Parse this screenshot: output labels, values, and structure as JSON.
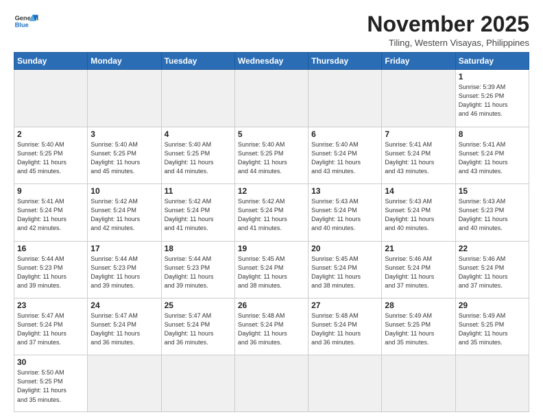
{
  "header": {
    "logo_line1": "General",
    "logo_line2": "Blue",
    "month_title": "November 2025",
    "location": "Tiling, Western Visayas, Philippines"
  },
  "weekdays": [
    "Sunday",
    "Monday",
    "Tuesday",
    "Wednesday",
    "Thursday",
    "Friday",
    "Saturday"
  ],
  "weeks": [
    [
      {
        "day": "",
        "info": ""
      },
      {
        "day": "",
        "info": ""
      },
      {
        "day": "",
        "info": ""
      },
      {
        "day": "",
        "info": ""
      },
      {
        "day": "",
        "info": ""
      },
      {
        "day": "",
        "info": ""
      },
      {
        "day": "1",
        "info": "Sunrise: 5:39 AM\nSunset: 5:26 PM\nDaylight: 11 hours\nand 46 minutes."
      }
    ],
    [
      {
        "day": "2",
        "info": "Sunrise: 5:40 AM\nSunset: 5:25 PM\nDaylight: 11 hours\nand 45 minutes."
      },
      {
        "day": "3",
        "info": "Sunrise: 5:40 AM\nSunset: 5:25 PM\nDaylight: 11 hours\nand 45 minutes."
      },
      {
        "day": "4",
        "info": "Sunrise: 5:40 AM\nSunset: 5:25 PM\nDaylight: 11 hours\nand 44 minutes."
      },
      {
        "day": "5",
        "info": "Sunrise: 5:40 AM\nSunset: 5:25 PM\nDaylight: 11 hours\nand 44 minutes."
      },
      {
        "day": "6",
        "info": "Sunrise: 5:40 AM\nSunset: 5:24 PM\nDaylight: 11 hours\nand 43 minutes."
      },
      {
        "day": "7",
        "info": "Sunrise: 5:41 AM\nSunset: 5:24 PM\nDaylight: 11 hours\nand 43 minutes."
      },
      {
        "day": "8",
        "info": "Sunrise: 5:41 AM\nSunset: 5:24 PM\nDaylight: 11 hours\nand 43 minutes."
      }
    ],
    [
      {
        "day": "9",
        "info": "Sunrise: 5:41 AM\nSunset: 5:24 PM\nDaylight: 11 hours\nand 42 minutes."
      },
      {
        "day": "10",
        "info": "Sunrise: 5:42 AM\nSunset: 5:24 PM\nDaylight: 11 hours\nand 42 minutes."
      },
      {
        "day": "11",
        "info": "Sunrise: 5:42 AM\nSunset: 5:24 PM\nDaylight: 11 hours\nand 41 minutes."
      },
      {
        "day": "12",
        "info": "Sunrise: 5:42 AM\nSunset: 5:24 PM\nDaylight: 11 hours\nand 41 minutes."
      },
      {
        "day": "13",
        "info": "Sunrise: 5:43 AM\nSunset: 5:24 PM\nDaylight: 11 hours\nand 40 minutes."
      },
      {
        "day": "14",
        "info": "Sunrise: 5:43 AM\nSunset: 5:24 PM\nDaylight: 11 hours\nand 40 minutes."
      },
      {
        "day": "15",
        "info": "Sunrise: 5:43 AM\nSunset: 5:23 PM\nDaylight: 11 hours\nand 40 minutes."
      }
    ],
    [
      {
        "day": "16",
        "info": "Sunrise: 5:44 AM\nSunset: 5:23 PM\nDaylight: 11 hours\nand 39 minutes."
      },
      {
        "day": "17",
        "info": "Sunrise: 5:44 AM\nSunset: 5:23 PM\nDaylight: 11 hours\nand 39 minutes."
      },
      {
        "day": "18",
        "info": "Sunrise: 5:44 AM\nSunset: 5:23 PM\nDaylight: 11 hours\nand 39 minutes."
      },
      {
        "day": "19",
        "info": "Sunrise: 5:45 AM\nSunset: 5:24 PM\nDaylight: 11 hours\nand 38 minutes."
      },
      {
        "day": "20",
        "info": "Sunrise: 5:45 AM\nSunset: 5:24 PM\nDaylight: 11 hours\nand 38 minutes."
      },
      {
        "day": "21",
        "info": "Sunrise: 5:46 AM\nSunset: 5:24 PM\nDaylight: 11 hours\nand 37 minutes."
      },
      {
        "day": "22",
        "info": "Sunrise: 5:46 AM\nSunset: 5:24 PM\nDaylight: 11 hours\nand 37 minutes."
      }
    ],
    [
      {
        "day": "23",
        "info": "Sunrise: 5:47 AM\nSunset: 5:24 PM\nDaylight: 11 hours\nand 37 minutes."
      },
      {
        "day": "24",
        "info": "Sunrise: 5:47 AM\nSunset: 5:24 PM\nDaylight: 11 hours\nand 36 minutes."
      },
      {
        "day": "25",
        "info": "Sunrise: 5:47 AM\nSunset: 5:24 PM\nDaylight: 11 hours\nand 36 minutes."
      },
      {
        "day": "26",
        "info": "Sunrise: 5:48 AM\nSunset: 5:24 PM\nDaylight: 11 hours\nand 36 minutes."
      },
      {
        "day": "27",
        "info": "Sunrise: 5:48 AM\nSunset: 5:24 PM\nDaylight: 11 hours\nand 36 minutes."
      },
      {
        "day": "28",
        "info": "Sunrise: 5:49 AM\nSunset: 5:25 PM\nDaylight: 11 hours\nand 35 minutes."
      },
      {
        "day": "29",
        "info": "Sunrise: 5:49 AM\nSunset: 5:25 PM\nDaylight: 11 hours\nand 35 minutes."
      }
    ],
    [
      {
        "day": "30",
        "info": "Sunrise: 5:50 AM\nSunset: 5:25 PM\nDaylight: 11 hours\nand 35 minutes."
      },
      {
        "day": "",
        "info": ""
      },
      {
        "day": "",
        "info": ""
      },
      {
        "day": "",
        "info": ""
      },
      {
        "day": "",
        "info": ""
      },
      {
        "day": "",
        "info": ""
      },
      {
        "day": "",
        "info": ""
      }
    ]
  ]
}
